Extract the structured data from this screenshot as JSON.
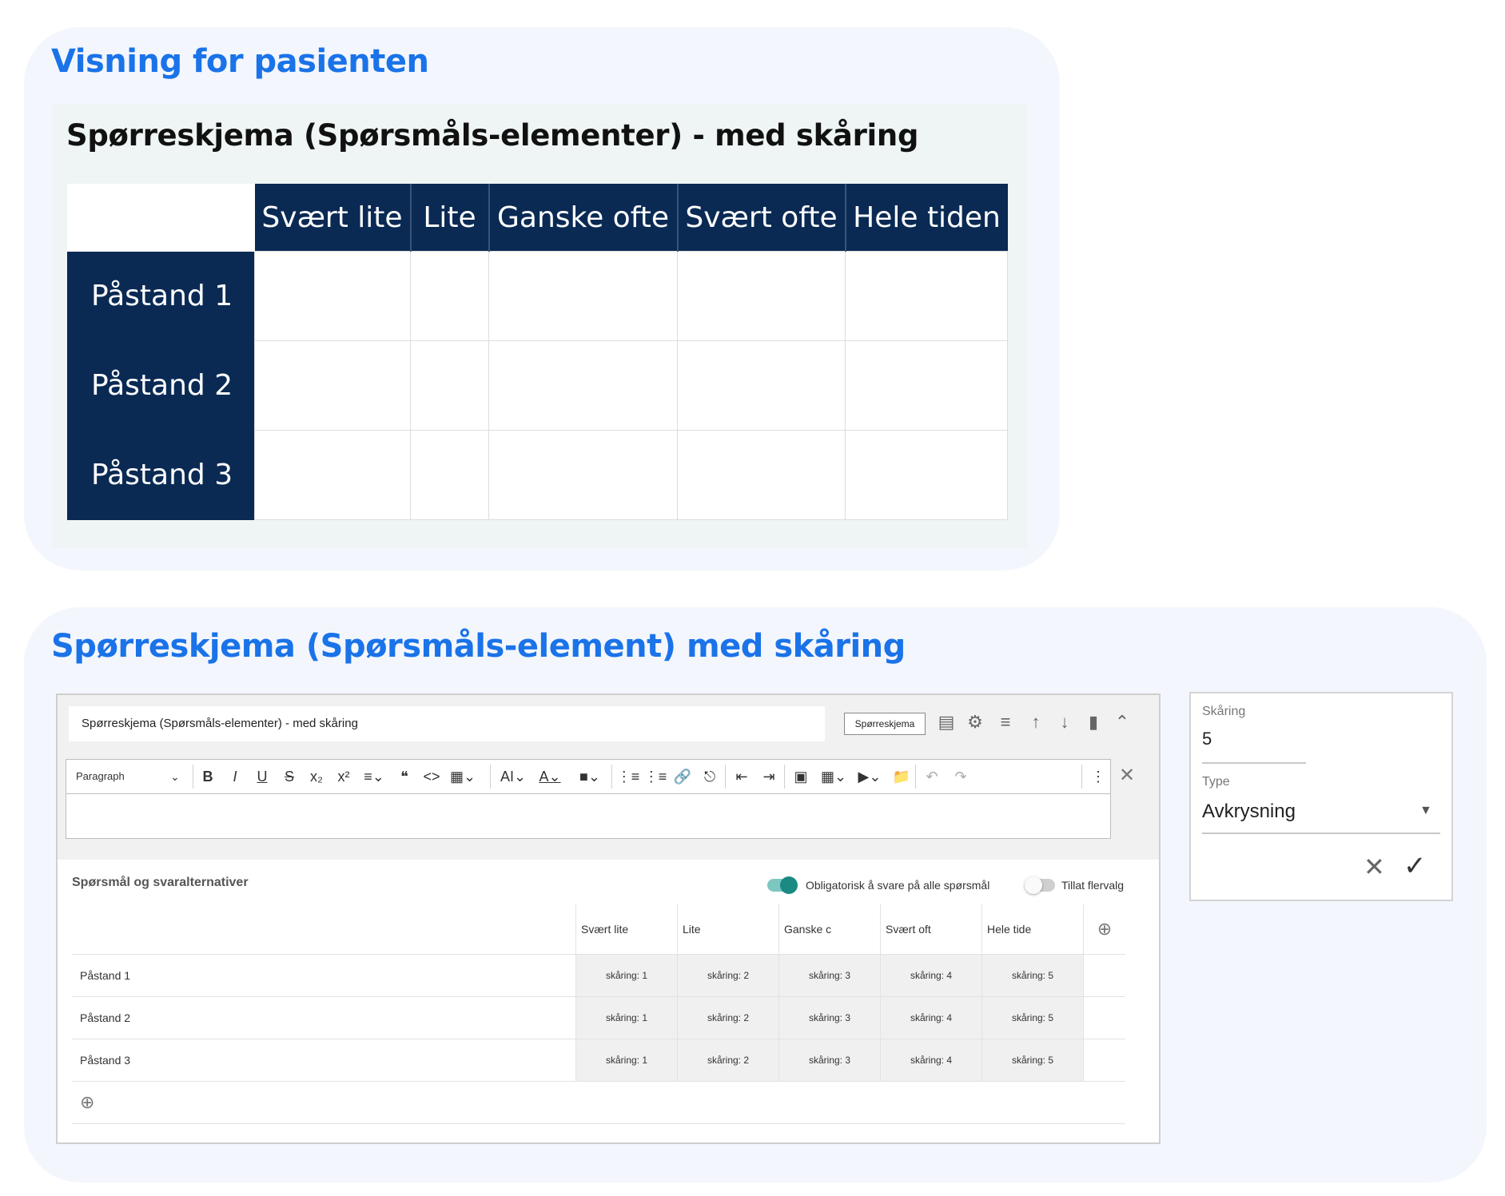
{
  "patient_view": {
    "title": "Visning for pasienten",
    "heading": "Spørreskjema (Spørsmåls-elementer) - med skåring",
    "columns": [
      "Svært lite",
      "Lite",
      "Ganske ofte",
      "Svært ofte",
      "Hele tiden"
    ],
    "rows": [
      "Påstand 1",
      "Påstand 2",
      "Påstand 3"
    ]
  },
  "editor_view": {
    "title": "Spørreskjema (Spørsmåls-element) med skåring",
    "title_input": "Spørreskjema (Spørsmåls-elementer) - med skåring",
    "type_badge": "Spørreskjema",
    "toolbar": {
      "paragraph": "Paragraph"
    },
    "qa": {
      "label": "Spørsmål og svaralternativer",
      "required_toggle": "Obligatorisk å svare på alle spørsmål",
      "required_on": true,
      "multi_toggle": "Tillat flervalg",
      "multi_on": false,
      "columns": [
        "Svært lite",
        "Lite",
        "Ganske c",
        "Svært oft",
        "Hele tide"
      ],
      "rows": [
        {
          "label": "Påstand 1",
          "scores": [
            "skåring: 1",
            "skåring: 2",
            "skåring: 3",
            "skåring: 4",
            "skåring: 5"
          ]
        },
        {
          "label": "Påstand 2",
          "scores": [
            "skåring: 1",
            "skåring: 2",
            "skåring: 3",
            "skåring: 4",
            "skåring: 5"
          ]
        },
        {
          "label": "Påstand 3",
          "scores": [
            "skåring: 1",
            "skåring: 2",
            "skåring: 3",
            "skåring: 4",
            "skåring: 5"
          ]
        }
      ]
    }
  },
  "scoring_panel": {
    "score_label": "Skåring",
    "score_value": "5",
    "type_label": "Type",
    "type_value": "Avkrysning"
  },
  "colors": {
    "accent": "#1a73e8",
    "header_navy": "#0a2a54",
    "toggle_on": "#1a8a82"
  }
}
